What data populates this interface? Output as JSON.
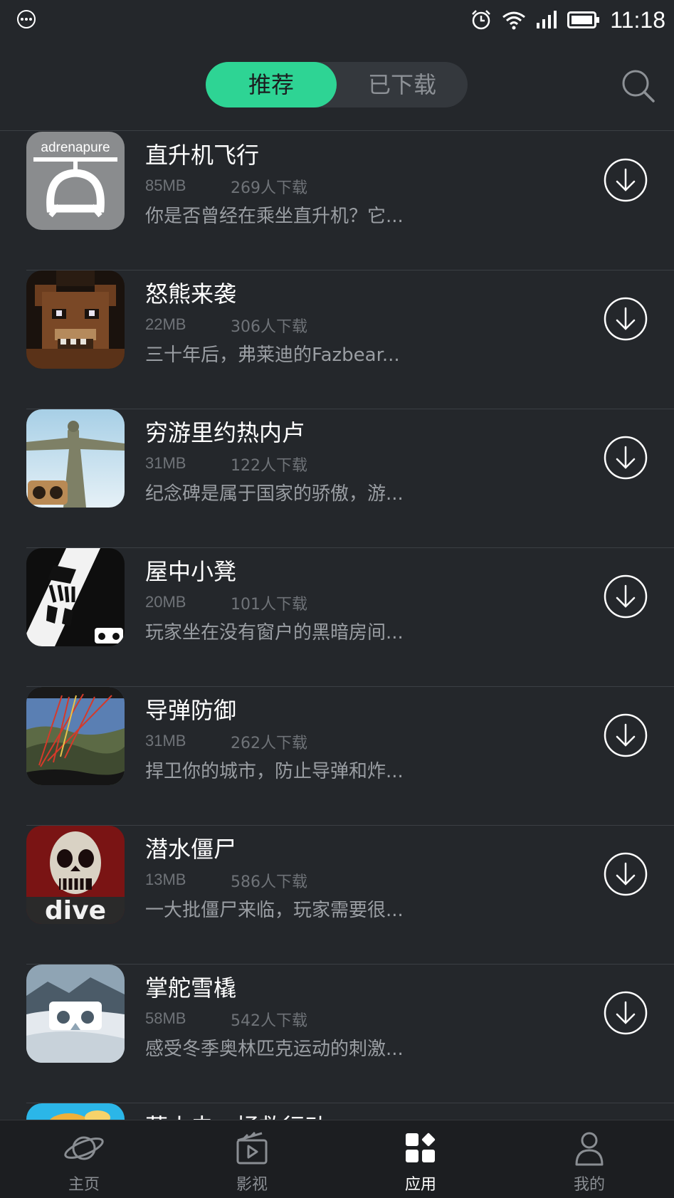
{
  "status_bar": {
    "time": "11:18",
    "icons": [
      "more-dots-icon",
      "alarm-clock-icon",
      "wifi-icon",
      "signal-icon",
      "battery-icon"
    ]
  },
  "header": {
    "tabs": [
      {
        "label": "推荐",
        "active": true
      },
      {
        "label": "已下载",
        "active": false
      }
    ],
    "search_icon": "search-icon",
    "accent_color": "#2ed494"
  },
  "apps": [
    {
      "title": "直升机飞行",
      "size": "85MB",
      "downloads": "269人下载",
      "desc": "你是否曾经在乘坐直升机？它...",
      "icon": "adrenapure-helicopter-icon",
      "icon_text": "adrenapure"
    },
    {
      "title": "怒熊来袭",
      "size": "22MB",
      "downloads": "306人下载",
      "desc": "三十年后，弗莱迪的Fazbear...",
      "icon": "blocky-bear-icon"
    },
    {
      "title": "穷游里约热内卢",
      "size": "31MB",
      "downloads": "122人下载",
      "desc": "纪念碑是属于国家的骄傲，游...",
      "icon": "christ-statue-icon"
    },
    {
      "title": "屋中小凳",
      "size": "20MB",
      "downloads": "101人下载",
      "desc": "玩家坐在没有窗户的黑暗房间...",
      "icon": "stool-icon"
    },
    {
      "title": "导弹防御",
      "size": "31MB",
      "downloads": "262人下载",
      "desc": "捍卫你的城市，防止导弹和炸...",
      "icon": "missile-defense-icon"
    },
    {
      "title": "潜水僵尸",
      "size": "13MB",
      "downloads": "586人下载",
      "desc": "一大批僵尸来临，玩家需要很...",
      "icon": "zombie-dive-icon",
      "icon_text": "dive"
    },
    {
      "title": "掌舵雪橇",
      "size": "58MB",
      "downloads": "542人下载",
      "desc": "感受冬季奥林匹克运动的刺激...",
      "icon": "snow-sled-icon"
    },
    {
      "title": "萤火虫：拯救行动",
      "size": "",
      "downloads": "",
      "desc": "",
      "icon": "firefly-icon"
    }
  ],
  "bottom_nav": [
    {
      "label": "主页",
      "icon": "planet-icon",
      "active": false
    },
    {
      "label": "影视",
      "icon": "film-play-icon",
      "active": false
    },
    {
      "label": "应用",
      "icon": "apps-grid-icon",
      "active": true
    },
    {
      "label": "我的",
      "icon": "person-icon",
      "active": false
    }
  ]
}
